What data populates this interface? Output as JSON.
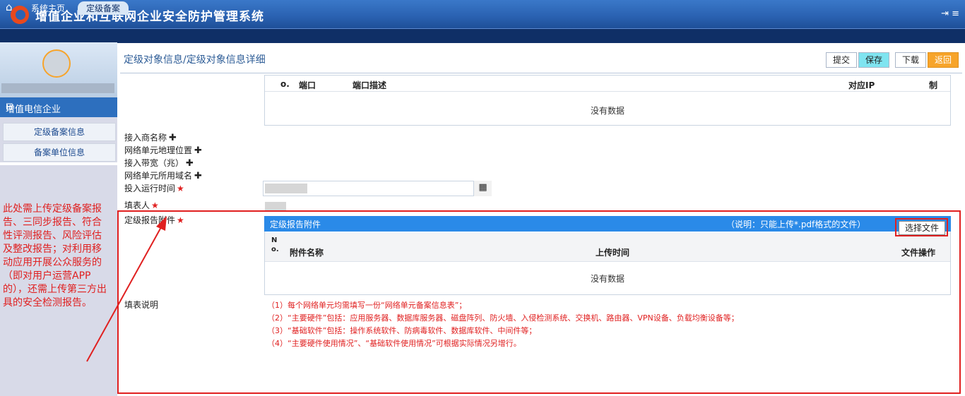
{
  "app": {
    "title": "增值企业和互联网企业安全防护管理系统",
    "header_icons": "⇥ ≡"
  },
  "nav": {
    "tabs": [
      {
        "label": "系统主页"
      },
      {
        "label": "定级备案"
      }
    ]
  },
  "sidebar": {
    "section_title": "增值电信企业",
    "items": [
      {
        "label": "定级备案信息"
      },
      {
        "label": "备案单位信息"
      }
    ]
  },
  "annotation": "此处需上传定级备案报告、三同步报告、符合性评测报告、风险评估及整改报告；对利用移动应用开展公众服务的（即对用户运营APP的），还需上传第三方出具的安全检测报告。",
  "breadcrumb": "定级对象信息/定级对象信息详细",
  "toolbar": {
    "submit": "提交",
    "save": "保存",
    "download": "下载",
    "back": "返回"
  },
  "port_table": {
    "columns": [
      "o.",
      "端口",
      "端口描述",
      "对应IP",
      "制"
    ],
    "empty_text": "没有数据"
  },
  "form_labels": {
    "access_provider": "接入商名称",
    "geo_location": "网络单元地理位置",
    "bandwidth": "接入带宽（兆）",
    "domain": "网络单元所用域名",
    "run_time": "投入运行时间",
    "filler": "填表人",
    "attachment": "定级报告附件",
    "instructions": "填表说明"
  },
  "attachment_table": {
    "title": "定级报告附件",
    "note": "（说明：只能上传*.pdf格式的文件）",
    "choose_button": "选择文件",
    "columns": [
      "N\no.",
      "附件名称",
      "上传时间",
      "文件操作"
    ],
    "empty_text": "没有数据"
  },
  "instructions": [
    "（1）每个网络单元均需填写一份“网络单元备案信息表”；",
    "（2）“主要硬件”包括：应用服务器、数据库服务器、磁盘阵列、防火墙、入侵检测系统、交换机、路由器、VPN设备、负载均衡设备等；",
    "（3）“基础软件”包括：操作系统软件、防病毒软件、数据库软件、中间件等；",
    "（4）“主要硬件使用情况”、“基础软件使用情况”可根据实际情况另增行。"
  ]
}
